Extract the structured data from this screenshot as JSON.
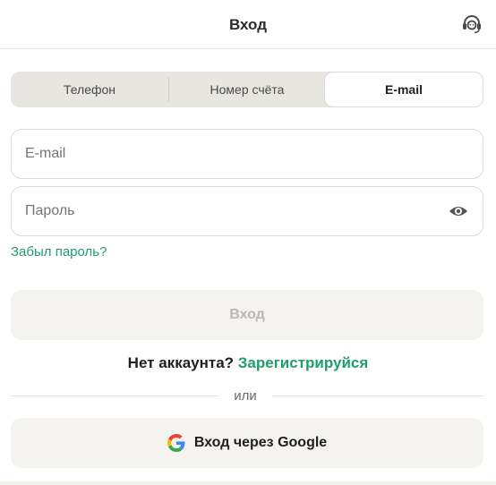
{
  "header": {
    "title": "Вход",
    "support_icon": "headset-icon"
  },
  "tabs": [
    {
      "label": "Телефон",
      "active": false
    },
    {
      "label": "Номер счёта",
      "active": false
    },
    {
      "label": "E-mail",
      "active": true
    }
  ],
  "form": {
    "email": {
      "placeholder": "E-mail",
      "value": ""
    },
    "password": {
      "placeholder": "Пароль",
      "value": "",
      "toggle_icon": "eye-icon"
    },
    "forgot_password": "Забыл пароль?",
    "submit_label": "Вход"
  },
  "register": {
    "prompt": "Нет аккаунта?",
    "link": "Зарегистрируйся"
  },
  "divider_text": "или",
  "google": {
    "label": "Вход через Google",
    "icon": "google-icon"
  },
  "colors": {
    "accent": "#1f9e6c",
    "tab_bg": "#e7e6e1",
    "button_bg": "#f4f3ef"
  }
}
